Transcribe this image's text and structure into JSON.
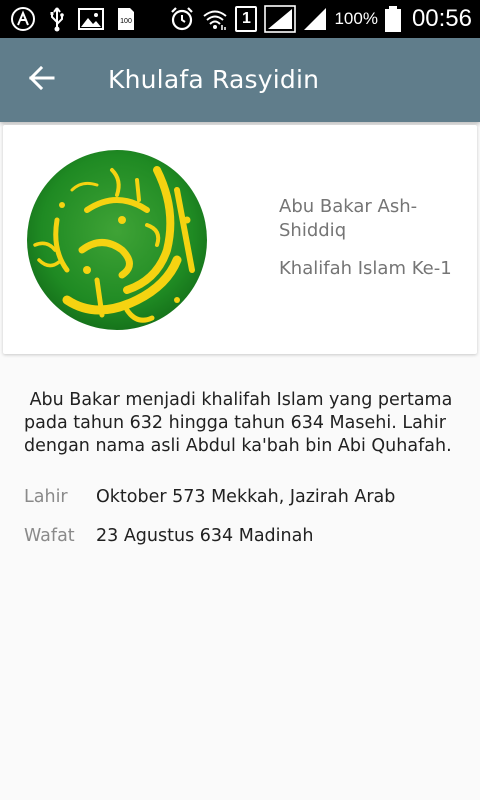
{
  "status_bar": {
    "battery_percent": "100%",
    "time": "00:56",
    "sim_slot": "1",
    "left_icons": [
      "assistant-icon",
      "usb-icon",
      "image-icon",
      "sd-card-icon"
    ],
    "right_icons": [
      "alarm-icon",
      "wifi-icon",
      "sim-icon",
      "signal-icon",
      "signal-icon",
      "battery-icon"
    ]
  },
  "toolbar": {
    "title": "Khulafa Rasyidin",
    "back_icon": "arrow-left-icon",
    "color": "#607d8b"
  },
  "card": {
    "name": "Abu Bakar Ash-Shiddiq",
    "subtitle": "Khalifah Islam Ke-1",
    "image_icon": "calligraphy-portrait"
  },
  "content": {
    "description": " Abu Bakar menjadi khalifah Islam yang pertama pada tahun 632 hingga tahun 634 Masehi. Lahir dengan nama asli Abdul ka'bah bin Abi Quhafah.",
    "born_label": "Lahir",
    "born_value": "Oktober 573 Mekkah, Jazirah Arab",
    "died_label": "Wafat",
    "died_value": "23 Agustus 634 Madinah"
  }
}
